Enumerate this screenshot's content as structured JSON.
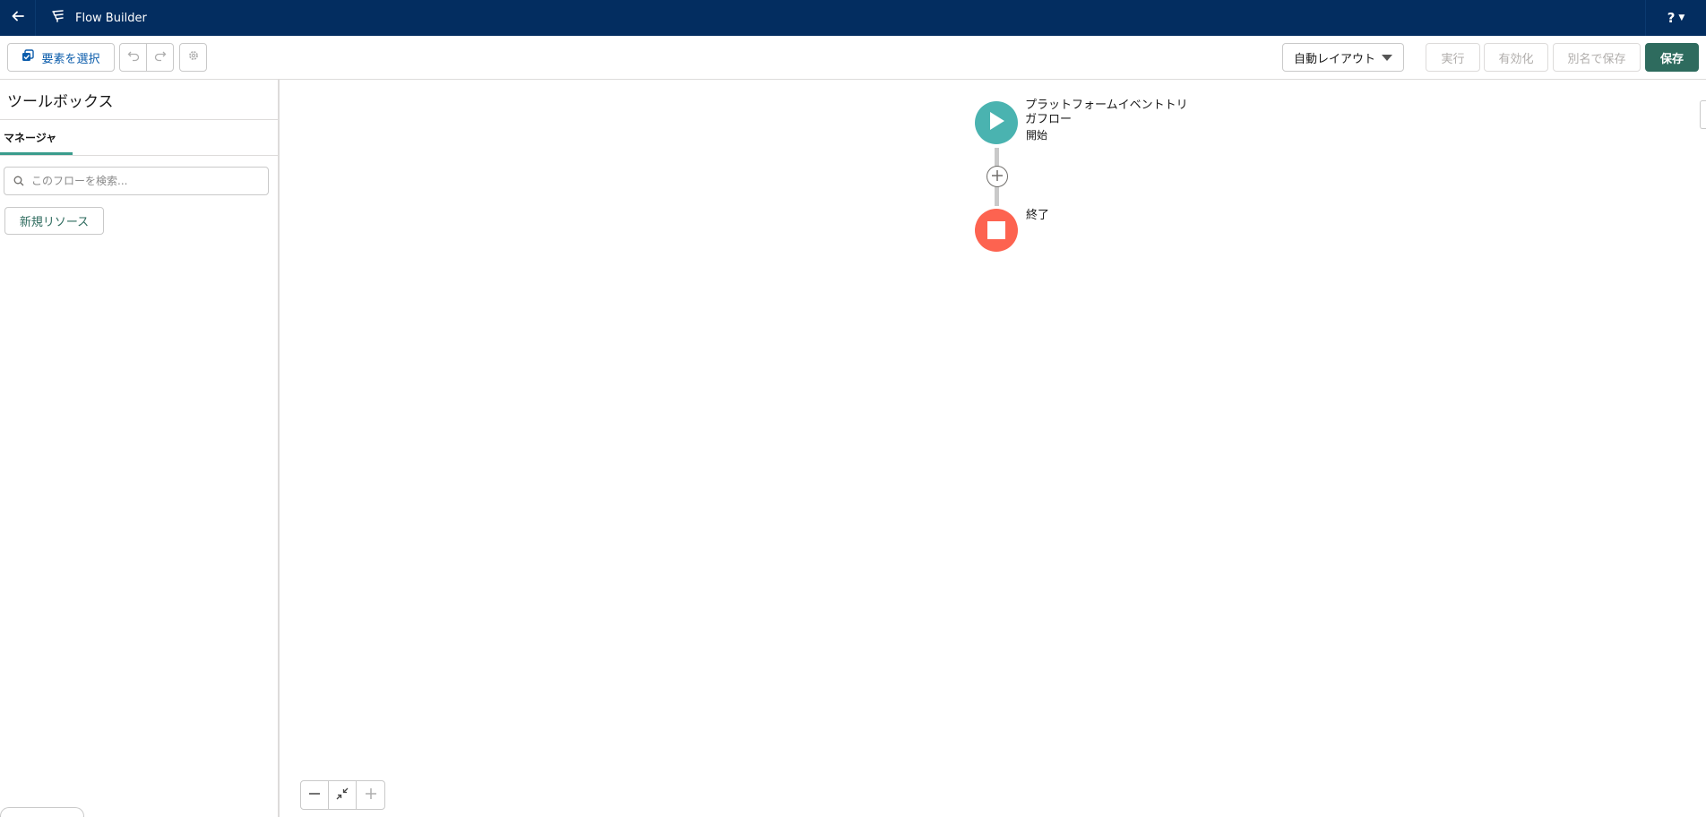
{
  "header": {
    "app_title": "Flow Builder",
    "help_label": "?"
  },
  "toolbar": {
    "select_elements_label": "要素を選択",
    "layout_select_value": "自動レイアウト",
    "run_label": "実行",
    "activate_label": "有効化",
    "save_as_label": "別名で保存",
    "save_label": "保存"
  },
  "toolbox": {
    "title": "ツールボックス",
    "tabs": [
      {
        "label": "マネージャ",
        "selected": true
      }
    ],
    "search": {
      "placeholder": "このフローを検索...",
      "value": ""
    },
    "new_resource_label": "新規リソース"
  },
  "canvas": {
    "start_node": {
      "title": "プラットフォームイベントトリガフロー",
      "subtitle": "開始",
      "color": "#4ab3b0"
    },
    "end_node": {
      "title": "終了",
      "color": "#fd6350"
    }
  },
  "colors": {
    "header_bg": "#032d60",
    "save_button": "#2e6b5e",
    "tab_indicator": "#3a9c8c"
  }
}
